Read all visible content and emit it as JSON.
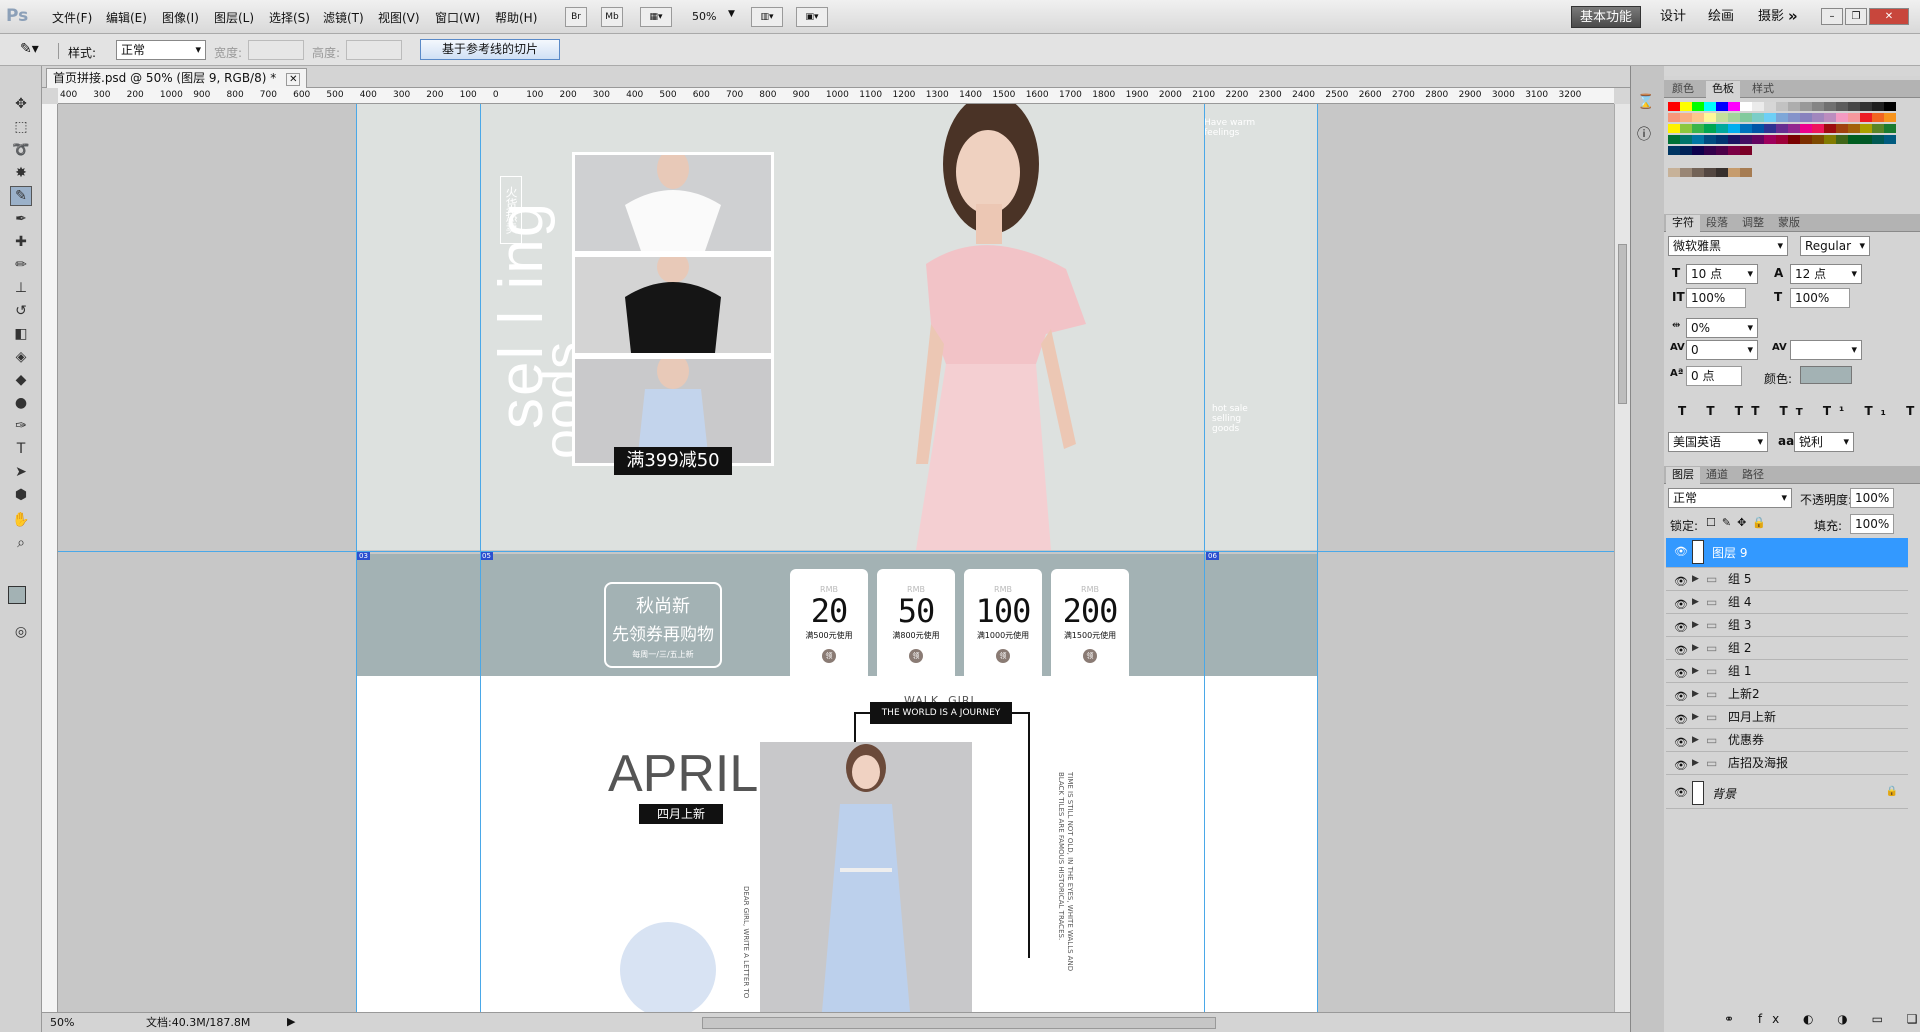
{
  "app": {
    "logo": "Ps"
  },
  "menu": [
    "文件(F)",
    "编辑(E)",
    "图像(I)",
    "图层(L)",
    "选择(S)",
    "滤镜(T)",
    "视图(V)",
    "窗口(W)",
    "帮助(H)"
  ],
  "menu_tools": {
    "br": "Br",
    "mb": "Mb",
    "zoom": "50%"
  },
  "workspaces": {
    "active": "基本功能",
    "items": [
      "设计",
      "绘画",
      "摄影"
    ]
  },
  "options": {
    "style_label": "样式:",
    "style_value": "正常",
    "width_label": "宽度:",
    "height_label": "高度:",
    "slice_button": "基于参考线的切片"
  },
  "doc": {
    "tab": "首页拼接.psd @ 50% (图层 9, RGB/8) *",
    "zoom": "50%",
    "doc_info": "文档:40.3M/187.8M"
  },
  "ruler": [
    "400",
    "300",
    "200",
    "1000",
    "900",
    "800",
    "700",
    "600",
    "500",
    "400",
    "300",
    "200",
    "100",
    "0",
    "100",
    "200",
    "300",
    "400",
    "500",
    "600",
    "700",
    "800",
    "900",
    "1000",
    "1100",
    "1200",
    "1300",
    "1400",
    "1500",
    "1600",
    "1700",
    "1800",
    "1900",
    "2000",
    "2100",
    "2200",
    "2300",
    "2400",
    "2500",
    "2600",
    "2700",
    "2800",
    "2900",
    "3000",
    "3100",
    "3200"
  ],
  "banner": {
    "selling": "sel l ing",
    "goods": "oods",
    "hot_tag": "火货热卖",
    "promo": "满399减50",
    "side_text_top": "Have warm feelings",
    "side_text_bottom": "hot sale selling goods"
  },
  "coupons": {
    "title": "秋尚新",
    "subtitle": "先领券再购物",
    "note": "每周一/三/五上新",
    "items": [
      {
        "currency": "RMB",
        "amount": "20",
        "cond": "满500元使用",
        "btn": "领"
      },
      {
        "currency": "RMB",
        "amount": "50",
        "cond": "满800元使用",
        "btn": "领"
      },
      {
        "currency": "RMB",
        "amount": "100",
        "cond": "满1000元使用",
        "btn": "领"
      },
      {
        "currency": "RMB",
        "amount": "200",
        "cond": "满1500元使用",
        "btn": "领"
      }
    ]
  },
  "april": {
    "walk": "WALK, GIRL",
    "journey": "THE WORLD IS A JOURNEY",
    "title": "APRIL",
    "tag": "四月上新",
    "vertical_1": "TIME IS STILL NOT OLD, IN THE EYES, WHITE WALLS AND BLACK TILES ARE FAMOUS HISTORICAL TRACES.",
    "vertical_2": "DEAR GIRL, WRITE A LETTER TO"
  },
  "slice_labels": [
    "03",
    "05",
    "06"
  ],
  "panels": {
    "color_tabs": [
      "颜色",
      "色板",
      "样式"
    ],
    "swatches": [
      "#ff0000",
      "#ffff00",
      "#00ff00",
      "#00ffff",
      "#0000ff",
      "#ff00ff",
      "#ffffff",
      "#ebebeb",
      "#d6d6d6",
      "#c2c2c2",
      "#adadad",
      "#999999",
      "#858585",
      "#707070",
      "#5c5c5c",
      "#474747",
      "#333333",
      "#1f1f1f",
      "#000000",
      "#ff6b6b",
      "#ffa86b",
      "#ffe06b",
      "#c5e86b",
      "#6be8a8"
    ],
    "char_tabs": [
      "字符",
      "段落",
      "调整",
      "蒙版"
    ],
    "font_family": "微软雅黑",
    "font_style": "Regular",
    "font_size": "10 点",
    "leading": "12 点",
    "vscale": "100%",
    "hscale": "100%",
    "tracking_pct": "0%",
    "kerning": "0",
    "baseline": "0 点",
    "color_label": "颜色:",
    "text_color": "#a3b2b4",
    "language": "美国英语",
    "aa_label": "aa",
    "aa": "锐利",
    "layer_tabs": [
      "图层",
      "通道",
      "路径"
    ],
    "blend": "正常",
    "opacity_label": "不透明度:",
    "opacity": "100%",
    "lock_label": "锁定:",
    "fill_label": "填充:",
    "fill": "100%",
    "layers": [
      {
        "name": "图层 9",
        "type": "layer",
        "selected": true
      },
      {
        "name": "组 5",
        "type": "group"
      },
      {
        "name": "组 4",
        "type": "group"
      },
      {
        "name": "组 3",
        "type": "group"
      },
      {
        "name": "组 2",
        "type": "group"
      },
      {
        "name": "组 1",
        "type": "group"
      },
      {
        "name": "上新2",
        "type": "group"
      },
      {
        "name": "四月上新",
        "type": "group"
      },
      {
        "name": "优惠券",
        "type": "group"
      },
      {
        "name": "店招及海报",
        "type": "group"
      },
      {
        "name": "背景",
        "type": "background"
      }
    ]
  },
  "colors": {
    "accent": "#3399ff",
    "banner_bg": "#dde1df",
    "coupon_bg": "#a3b2b4",
    "dark": "#111111"
  }
}
